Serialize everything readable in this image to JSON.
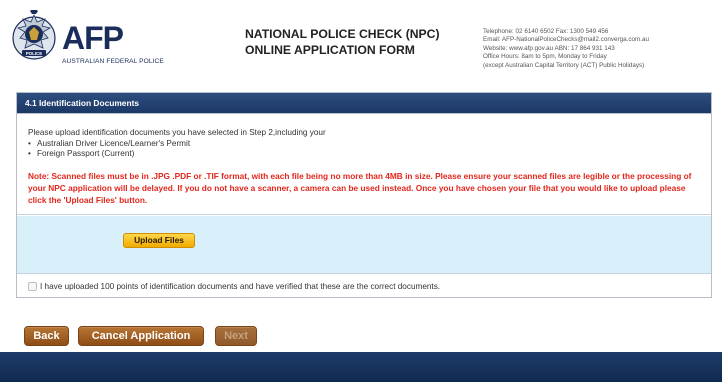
{
  "header": {
    "logo_text": "AFP",
    "logo_subtext": "AUSTRALIAN FEDERAL POLICE",
    "crest_text": "POLICE",
    "title_line1": "NATIONAL POLICE CHECK (NPC)",
    "title_line2": "ONLINE APPLICATION FORM",
    "contact": [
      "Telephone: 02 6140 6502  Fax: 1300 549 456",
      "Email: AFP-NationalPoliceChecks@mail2.converga.com.au",
      "Website: www.afp.gov.au    ABN: 17 864 931 143",
      "Office Hours: 8am to 5pm, Monday to Friday",
      "(except Australian Capital Territory (ACT) Public Holidays)"
    ]
  },
  "section": {
    "title": "4.1 Identification Documents",
    "intro": "Please upload identification documents you have selected in Step 2,including your",
    "documents": [
      "Australian Driver Licence/Learner's Permit",
      "Foreign Passport (Current)"
    ],
    "note": "Note: Scanned files must be in .JPG .PDF or .TIF format, with each file being no more than 4MB in size. Please ensure your scanned files are legible or the processing of your NPC application will be delayed. If you do not have a scanner, a camera can be used instead. Once you have chosen your file that you would like to upload please click the 'Upload Files' button.",
    "upload_button": "Upload Files",
    "confirm_label": "I have uploaded 100 points of identification documents and have verified that these are the correct documents.",
    "confirm_checked": false
  },
  "buttons": {
    "back": "Back",
    "cancel": "Cancel Application",
    "next": "Next"
  },
  "colors": {
    "navy": "#1c3765",
    "note_red": "#e2271d",
    "upload_bg": "#d7f0fa",
    "button_brown": "#a0622a",
    "upload_gold": "#f5b800"
  }
}
